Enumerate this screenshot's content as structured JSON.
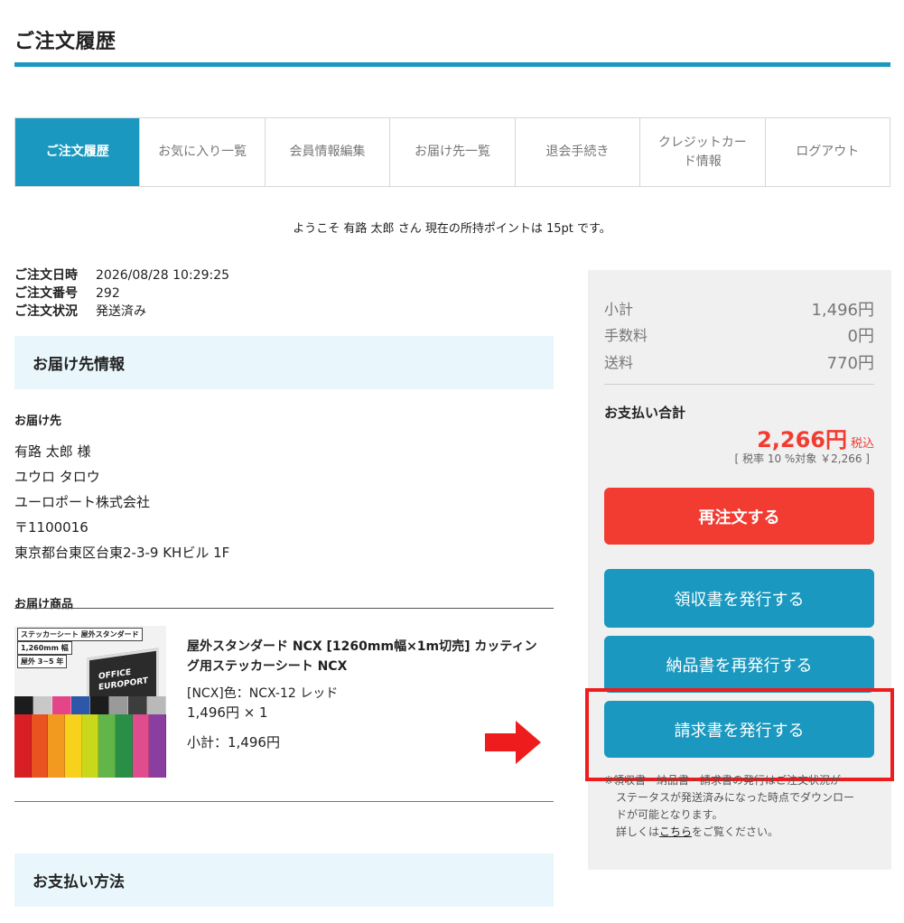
{
  "page": {
    "title": "ご注文履歴"
  },
  "tabs": [
    {
      "label": "ご注文履歴",
      "active": true
    },
    {
      "label": "お気に入り一覧",
      "active": false
    },
    {
      "label": "会員情報編集",
      "active": false
    },
    {
      "label": "お届け先一覧",
      "active": false
    },
    {
      "label": "退会手続き",
      "active": false
    },
    {
      "label": "クレジットカード情報",
      "active": false
    },
    {
      "label": "ログアウト",
      "active": false
    }
  ],
  "welcome": "ようこそ 有路 太郎 さん 現在の所持ポイントは 15pt です。",
  "order": {
    "date_label": "ご注文日時",
    "date": "2026/08/28 10:29:25",
    "number_label": "ご注文番号",
    "number": "292",
    "status_label": "ご注文状況",
    "status": "発送済み"
  },
  "shipping": {
    "section_title": "お届け先情報",
    "address_label": "お届け先",
    "name": "有路 太郎 様",
    "kana": "ユウロ タロウ",
    "company": "ユーロポート株式会社",
    "postal": "〒1100016",
    "address": "東京都台東区台東2-3-9 KHビル 1F"
  },
  "products": {
    "label": "お届け商品",
    "items": [
      {
        "name": "屋外スタンダード NCX [1260mm幅×1m切売] カッティング用ステッカーシート NCX",
        "variant": "[NCX]色：NCX-12 レッド",
        "qty": "1,496円 × 1",
        "subtotal": "小計：1,496円",
        "image_labels": [
          "ステッカーシート 屋外スタンダード",
          "1,260mm 幅",
          "屋外 3~5 年"
        ],
        "image_board": [
          "OFFICE",
          "EUROPORT"
        ]
      }
    ]
  },
  "payment_method": {
    "section_title": "お支払い方法"
  },
  "summary": {
    "subtotal_label": "小計",
    "subtotal": "1,496円",
    "fee_label": "手数料",
    "fee": "0円",
    "shipping_label": "送料",
    "shipping": "770円",
    "total_label": "お支払い合計",
    "total": "2,266円",
    "tax_inclusive": "税込",
    "tax_note": "[ 税率 10 %対象 ￥2,266 ]"
  },
  "buttons": {
    "reorder": "再注文する",
    "receipt": "領収書を発行する",
    "delivery_note": "納品書を再発行する",
    "invoice": "請求書を発行する"
  },
  "notice": {
    "line1": "※領収書・納品書・請求書の発行はご注文状況が",
    "line2": "ステータスが発送済みになった時点でダウンロー",
    "line3": "ドが可能となります。",
    "line4_prefix": "詳しくは",
    "line4_link": "こちら",
    "line4_suffix": "をご覧ください。"
  },
  "colors": {
    "accent": "#1a98bf",
    "danger": "#f23c32",
    "highlight": "#ee1c1c",
    "section_bg": "#e9f7fd",
    "roll_colors": [
      "#d81f26",
      "#e8531f",
      "#f29a1f",
      "#f6d21c",
      "#c9d81a",
      "#62b548",
      "#2a8f46",
      "#e04d8e",
      "#8a3ea0"
    ],
    "roll_top_colors": [
      "#1c1c1c",
      "#c8c8c8",
      "#e44488",
      "#2d57a8",
      "#1c1c1c",
      "#9a9a9a",
      "#3d3d3d",
      "#b9b9b9"
    ]
  }
}
